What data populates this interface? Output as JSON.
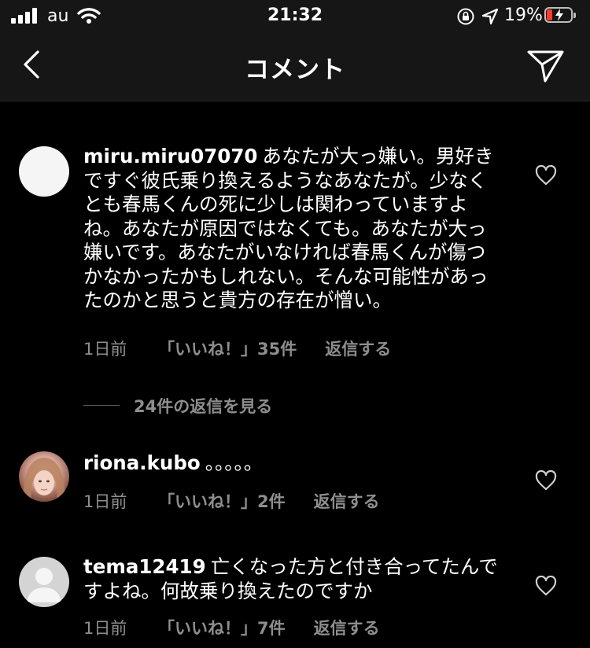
{
  "status_bar": {
    "carrier": "au",
    "time": "21:32",
    "battery_percent": "19%",
    "battery_level": 0.19,
    "battery_color": "#ff3b30"
  },
  "header": {
    "title": "コメント",
    "back_icon": "chevron-left-icon",
    "send_icon": "paper-plane-icon"
  },
  "comments": [
    {
      "username": "miru.miru07070",
      "text": "あなたが大っ嫌い。男好きですぐ彼氏乗り換えるようなあなたが。少なくとも春馬くんの死に少しは関わっていますよね。あなたが原因ではなくても。あなたが大っ嫌いです。あなたがいなければ春馬くんが傷つかなかったかもしれない。そんな可能性があったのかと思うと貴方の存在が憎い。",
      "time": "1日前",
      "likes": "「いいね！」35件",
      "reply": "返信する",
      "avatar": "blank-avatar"
    },
    {
      "username": "riona.kubo",
      "text": "。。。。。",
      "time": "1日前",
      "likes": "「いいね！」2件",
      "reply": "返信する",
      "avatar": "photo-avatar"
    },
    {
      "username": "tema12419",
      "text": "亡くなった方と付き合ってたんですよね。何故乗り換えたのですか",
      "time": "1日前",
      "likes": "「いいね！」7件",
      "reply": "返信する",
      "avatar": "default-avatar"
    }
  ],
  "view_replies": "24件の返信を見る",
  "colors": {
    "background": "#000000",
    "bar": "#161616",
    "secondary_text": "#8e8e8e"
  }
}
